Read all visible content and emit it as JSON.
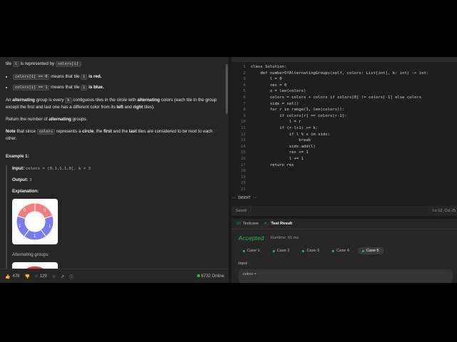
{
  "description": {
    "tile_line_a": "tile ",
    "tile_code": "i",
    "tile_line_b": " is represented by ",
    "colors_i_code": "colors[i]",
    "bullet1_code": "colors[i] == 0",
    "bullet1_text": " means that tile ",
    "bullet1_code2": "i",
    "bullet1_end": " is red.",
    "bullet2_code": "colors[i] == 1",
    "bullet2_text": " means that tile ",
    "bullet2_code2": "i",
    "bullet2_end": " is blue.",
    "para1_a": "An ",
    "para1_b": "alternating",
    "para1_c": " group is every ",
    "para1_k": "k",
    "para1_d": " contiguous tiles in the circle with ",
    "para1_e": "alternating",
    "para1_f": " colors (each tile in the group except the first and last one has a different color from its ",
    "para1_g": "left",
    "para1_h": " and ",
    "para1_i": "right",
    "para1_j": " tiles).",
    "para2_a": "Return the number of ",
    "para2_b": "alternating",
    "para2_c": " groups.",
    "note_a": "Note",
    "note_b": " that since ",
    "note_code": "colors",
    "note_c": " represents a ",
    "note_d": "circle",
    "note_e": ", the ",
    "note_f": "first",
    "note_g": " and the ",
    "note_h": "last",
    "note_i": " tiles are considered to be next to each other.",
    "example_title": "Example 1:",
    "input_label": "Input:",
    "input_value": "colors = [0,1,1,1,0], k = 3",
    "output_label": "Output:",
    "output_value": "3",
    "explanation_label": "Explanation:",
    "alternating_groups_label": "Alternating groups:"
  },
  "diagram": {
    "tile_labels": [
      "0",
      "1",
      "1",
      "1",
      "0"
    ],
    "red_color": "#f07c7c",
    "blue_color": "#7b7bf0"
  },
  "bottom_bar": {
    "likes": "476",
    "comments": "129",
    "online": "6732 Online"
  },
  "editor": {
    "lines": [
      "class Solution:",
      "    def numberOfAlternatingGroups(self, colors: List[int], k: int) -> int:",
      "        l = 0",
      "        res = 0",
      "        x = len(colors)",
      "        colors = colors + colors if colors[0] != colors[-1] else colors",
      "        sidx = set()",
      "        for r in range(1, len(colors)):",
      "            if colors[r] == colors[r-1]:",
      "                l = r",
      "            if (r-l+1) >= k:",
      "                if l % x in sidx:",
      "                    break",
      "                sidx.add(l)",
      "                res += 1",
      "                l += 1",
      "        return res",
      "",
      "",
      "",
      ""
    ],
    "line_numbers": [
      "1",
      "2",
      "3",
      "4",
      "5",
      "6",
      "7",
      "8",
      "9",
      "10",
      "11",
      "12",
      "13",
      "14",
      "15",
      "16",
      "17",
      "18",
      "19",
      "20",
      "21"
    ],
    "mode": "-- INSERT --",
    "saved": "Saved",
    "cursor": "Ln 12, Col 25"
  },
  "result": {
    "tab_testcase": "Testcase",
    "tab_result": "Test Result",
    "status": "Accepted",
    "runtime": "Runtime: 55 ms",
    "cases": [
      "Case 1",
      "Case 2",
      "Case 3",
      "Case 4",
      "Case 5"
    ],
    "selected_case": "Case 5",
    "input_label": "Input",
    "input_first": "colors ="
  }
}
